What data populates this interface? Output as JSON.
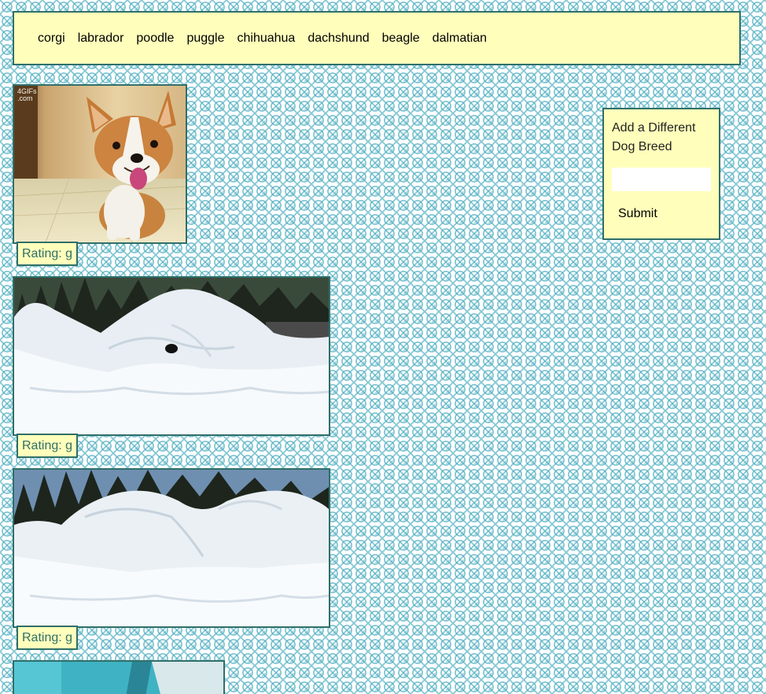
{
  "nav": {
    "breeds": [
      "corgi",
      "labrador",
      "poodle",
      "puggle",
      "chihuahua",
      "dachshund",
      "beagle",
      "dalmatian"
    ]
  },
  "gifs": [
    {
      "rating": "Rating: g",
      "watermark_line1": "4GIFs",
      "watermark_line2": ".com"
    },
    {
      "rating": "Rating: g"
    },
    {
      "rating": "Rating: g"
    },
    {
      "rating": ""
    }
  ],
  "form": {
    "label": "Add a Different Dog Breed",
    "input_value": "",
    "input_placeholder": "",
    "submit_label": "Submit"
  },
  "colors": {
    "panel_background": "#ffffbb",
    "border": "#2f6f6a",
    "rating_text": "#2f6f6a",
    "pattern": "#46aabe"
  }
}
